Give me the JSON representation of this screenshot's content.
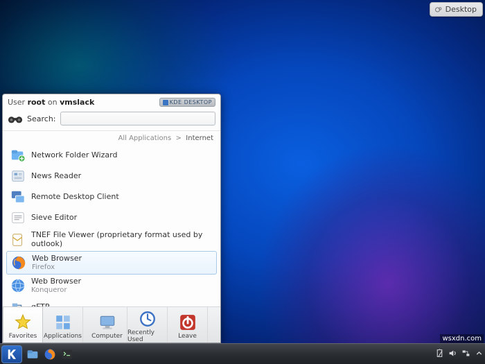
{
  "toolbox": {
    "label": "Desktop"
  },
  "user_header": {
    "prefix": "User ",
    "user": "root",
    "mid": " on ",
    "host": "vmslack"
  },
  "kde_badge": "KDE DESKTOP",
  "search": {
    "label": "Search:",
    "placeholder": ""
  },
  "breadcrumb": {
    "root": "All Applications",
    "sep": ">",
    "current": "Internet"
  },
  "apps": [
    {
      "label": "Network Folder Wizard",
      "sub": "",
      "icon": "folder-network",
      "selected": false
    },
    {
      "label": "News Reader",
      "sub": "",
      "icon": "news",
      "selected": false
    },
    {
      "label": "Remote Desktop Client",
      "sub": "",
      "icon": "remote-desktop",
      "selected": false
    },
    {
      "label": "Sieve Editor",
      "sub": "",
      "icon": "sieve",
      "selected": false
    },
    {
      "label": "TNEF File Viewer (proprietary format used by outlook)",
      "sub": "",
      "icon": "tnef",
      "selected": false
    },
    {
      "label": "Web Browser",
      "sub": "Firefox",
      "icon": "firefox",
      "selected": true
    },
    {
      "label": "Web Browser",
      "sub": "Konqueror",
      "icon": "konqueror",
      "selected": false
    },
    {
      "label": "gFTP",
      "sub": "",
      "icon": "gftp",
      "selected": false
    }
  ],
  "tabs": [
    {
      "label": "Favorites",
      "icon": "star",
      "active": true
    },
    {
      "label": "Applications",
      "icon": "apps",
      "active": false
    },
    {
      "label": "Computer",
      "icon": "computer",
      "active": false
    },
    {
      "label": "Recently Used",
      "icon": "clock",
      "active": false
    },
    {
      "label": "Leave",
      "icon": "leave",
      "active": false
    }
  ],
  "taskbar_launchers": [
    "dolphin",
    "firefox",
    "konsole"
  ],
  "tray_icons": [
    "clipboard",
    "volume",
    "network",
    "expand"
  ],
  "watermark": "wsxdn.com"
}
